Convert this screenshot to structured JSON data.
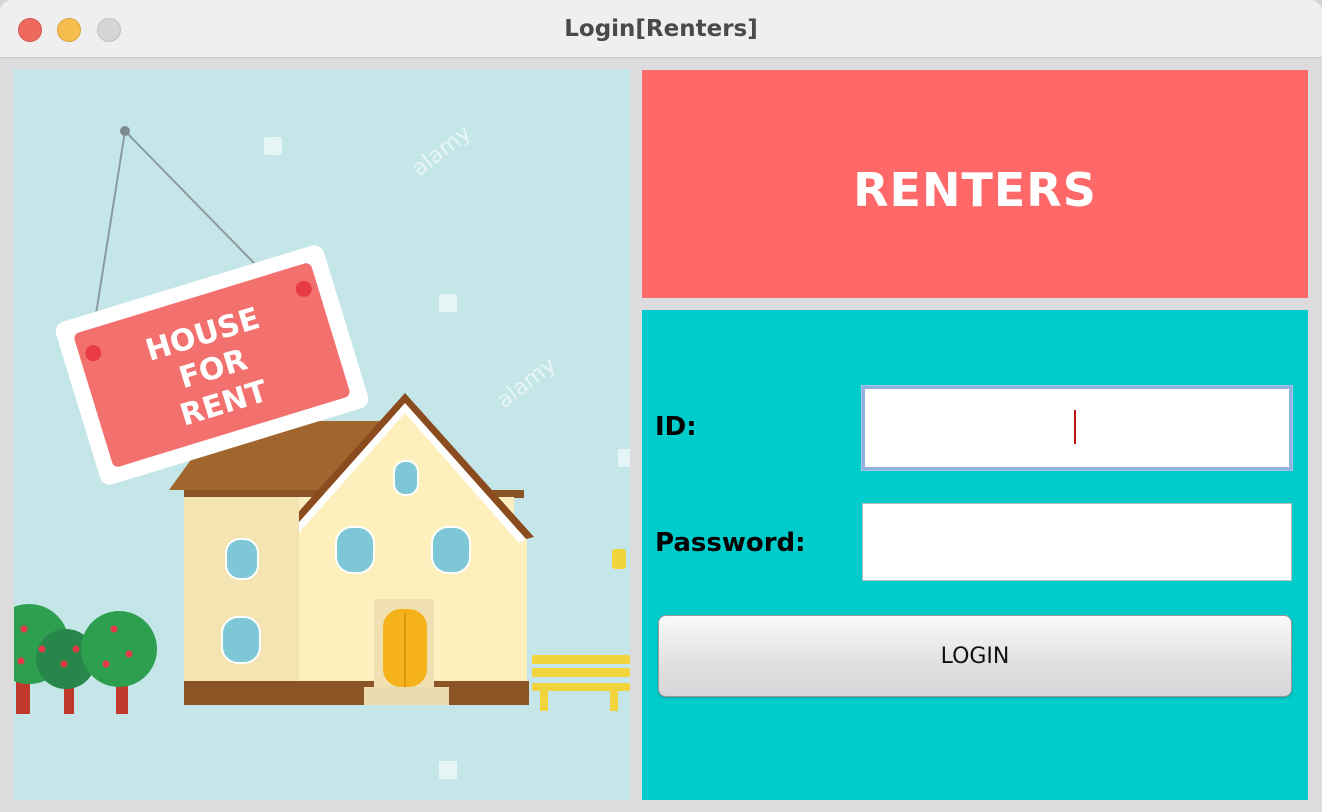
{
  "window": {
    "title": "Login[Renters]"
  },
  "illustration": {
    "sign_lines": [
      "HOUSE",
      "FOR",
      "RENT"
    ],
    "watermark": "alamy"
  },
  "header": {
    "title": "RENTERS"
  },
  "form": {
    "id_label": "ID:",
    "id_value": "",
    "password_label": "Password:",
    "password_value": "",
    "login_label": "LOGIN"
  },
  "colors": {
    "header_bg": "#ff6868",
    "form_bg": "#00cccc",
    "illustration_bg": "#c5e6e8"
  }
}
